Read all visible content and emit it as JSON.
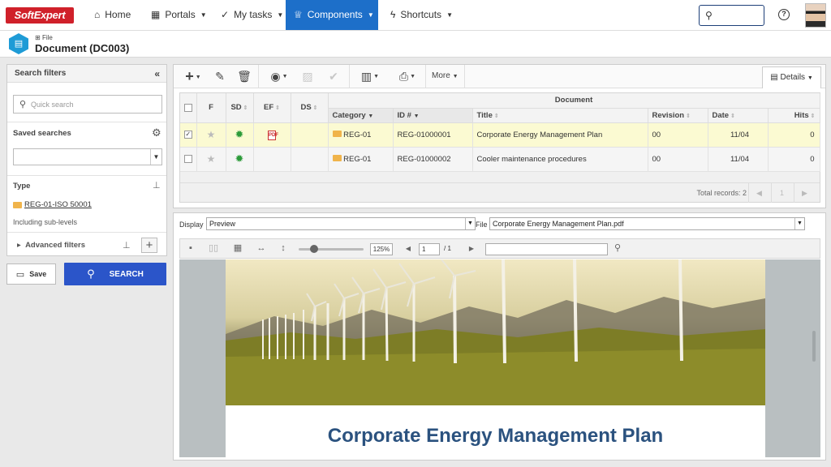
{
  "app": {
    "logo": "SoftExpert"
  },
  "nav": {
    "items": [
      {
        "label": "Home",
        "icon": "home-icon"
      },
      {
        "label": "Portals",
        "icon": "grid-icon"
      },
      {
        "label": "My tasks",
        "icon": "check-icon"
      },
      {
        "label": "Components",
        "icon": "trophy-icon",
        "active": true
      },
      {
        "label": "Shortcuts",
        "icon": "bolt-icon"
      }
    ],
    "help": "?"
  },
  "header": {
    "file_label": "File",
    "title": "Document (DC003)"
  },
  "filters": {
    "title": "Search filters",
    "quick_search_placeholder": "Quick search",
    "saved_searches": "Saved searches",
    "type_label": "Type",
    "type_value": "REG-01-ISO 50001",
    "sub_levels": "Including sub-levels",
    "advanced": "Advanced filters",
    "save": "Save",
    "search": "SEARCH"
  },
  "toolbar": {
    "more": "More",
    "details": "Details"
  },
  "grid": {
    "group_header": "Document",
    "columns": {
      "f": "F",
      "sd": "SD",
      "ef": "EF",
      "ds": "DS",
      "category": "Category",
      "id": "ID #",
      "title": "Title",
      "revision": "Revision",
      "date": "Date",
      "hits": "Hits"
    },
    "rows": [
      {
        "checked": true,
        "category": "REG-01",
        "id": "REG-01000001",
        "title": "Corporate Energy Management Plan",
        "revision": "00",
        "date": "11/04",
        "hits": "0"
      },
      {
        "checked": false,
        "category": "REG-01",
        "id": "REG-01000002",
        "title": "Cooler maintenance procedures",
        "revision": "00",
        "date": "11/04",
        "hits": "0"
      }
    ],
    "total_records": "Total records: 2",
    "page": "1"
  },
  "viewer": {
    "display_label": "Display",
    "display_value": "Preview",
    "file_label": "File",
    "file_value": "Corporate Energy Management Plan.pdf",
    "zoom": "125%",
    "page_current": "1",
    "page_total": "/ 1",
    "pdf_title": "Corporate Energy Management Plan"
  },
  "colors": {
    "accent": "#1d6fc9",
    "search_button": "#2b55c9",
    "logo": "#d0202a",
    "selected_row": "#fbfad2",
    "pdf_title": "#2b527f"
  }
}
